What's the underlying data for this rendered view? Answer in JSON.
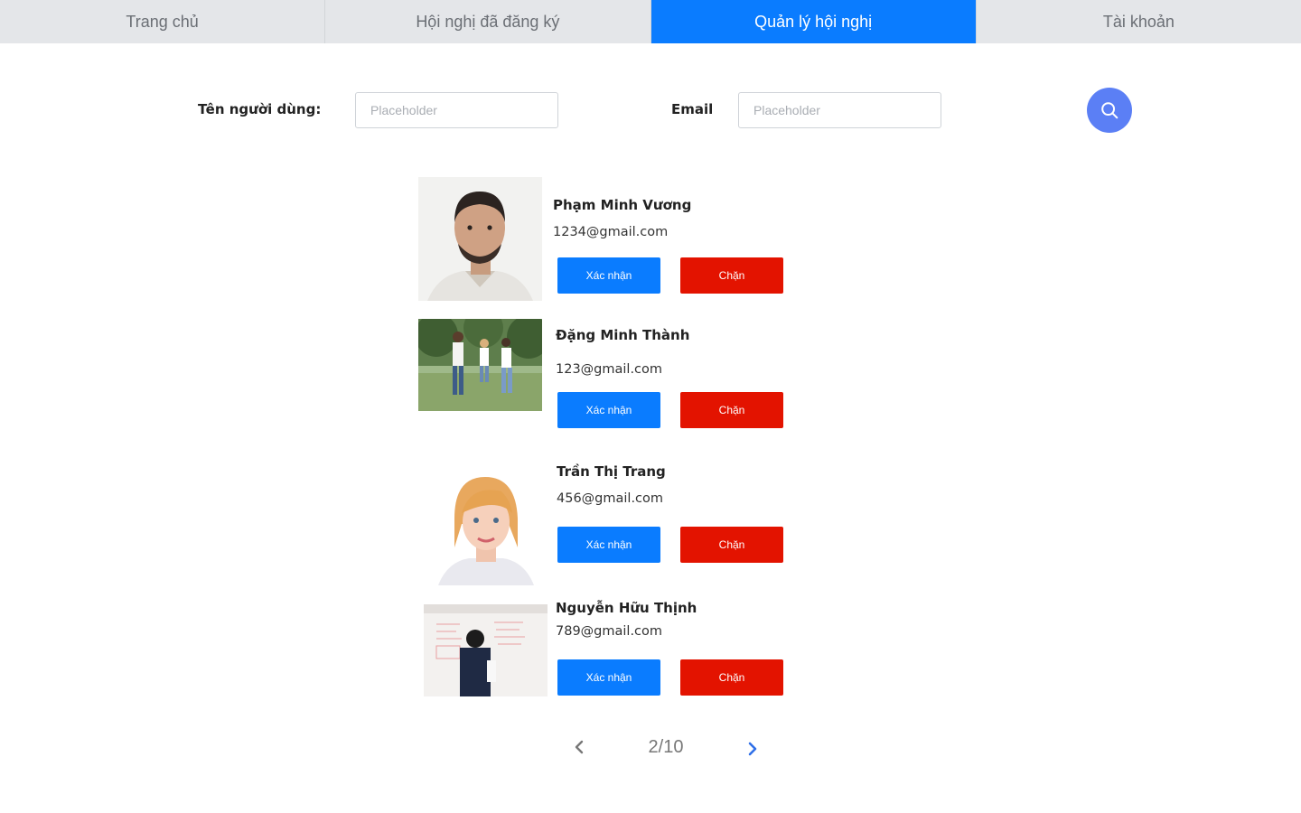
{
  "nav": {
    "tabs": [
      {
        "label": "Trang chủ"
      },
      {
        "label": "Hội nghị đã đăng ký"
      },
      {
        "label": "Quản lý hội nghị"
      },
      {
        "label": "Tài khoản"
      }
    ],
    "active_index": 2
  },
  "search": {
    "username_label": "Tên người dùng:",
    "username_placeholder": "Placeholder",
    "email_label": "Email",
    "email_placeholder": "Placeholder",
    "button_icon": "search-icon"
  },
  "users": [
    {
      "name": "Phạm Minh Vương",
      "email": "1234@gmail.com",
      "confirm_label": "Xác nhận",
      "block_label": "Chặn"
    },
    {
      "name": "Đặng Minh Thành",
      "email": "123@gmail.com",
      "confirm_label": "Xác nhận",
      "block_label": "Chặn"
    },
    {
      "name": "Trần Thị Trang",
      "email": "456@gmail.com",
      "confirm_label": "Xác nhận",
      "block_label": "Chặn"
    },
    {
      "name": "Nguyễn Hữu Thịnh",
      "email": "789@gmail.com",
      "confirm_label": "Xác nhận",
      "block_label": "Chặn"
    }
  ],
  "pagination": {
    "text": "2/10",
    "prev_icon": "chevron-left-icon",
    "next_icon": "chevron-right-icon"
  },
  "colors": {
    "accent": "#0a7cff",
    "danger": "#e31300",
    "search_button": "#5b7ff5",
    "nav_background": "#e4e6e9"
  }
}
